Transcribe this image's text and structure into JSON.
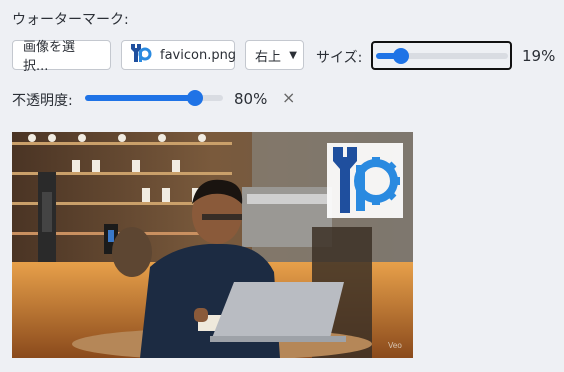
{
  "header": {
    "title": "ウォーターマーク:"
  },
  "controls": {
    "choose_button": "画像を選択...",
    "file_name": "favicon.png",
    "position_value": "右上",
    "size_label": "サイズ:",
    "size_value": "19%",
    "size_fraction": 0.19,
    "opacity_label": "不透明度:",
    "opacity_value": "80%",
    "opacity_fraction": 0.8,
    "reset_glyph": "×"
  },
  "preview": {
    "photo_credit": "Veo",
    "watermark_icon": "wrench-gear-p-logo"
  },
  "colors": {
    "accent": "#1f73e6",
    "logo_dark": "#1f4f9e",
    "logo_light": "#2a8ae0"
  }
}
